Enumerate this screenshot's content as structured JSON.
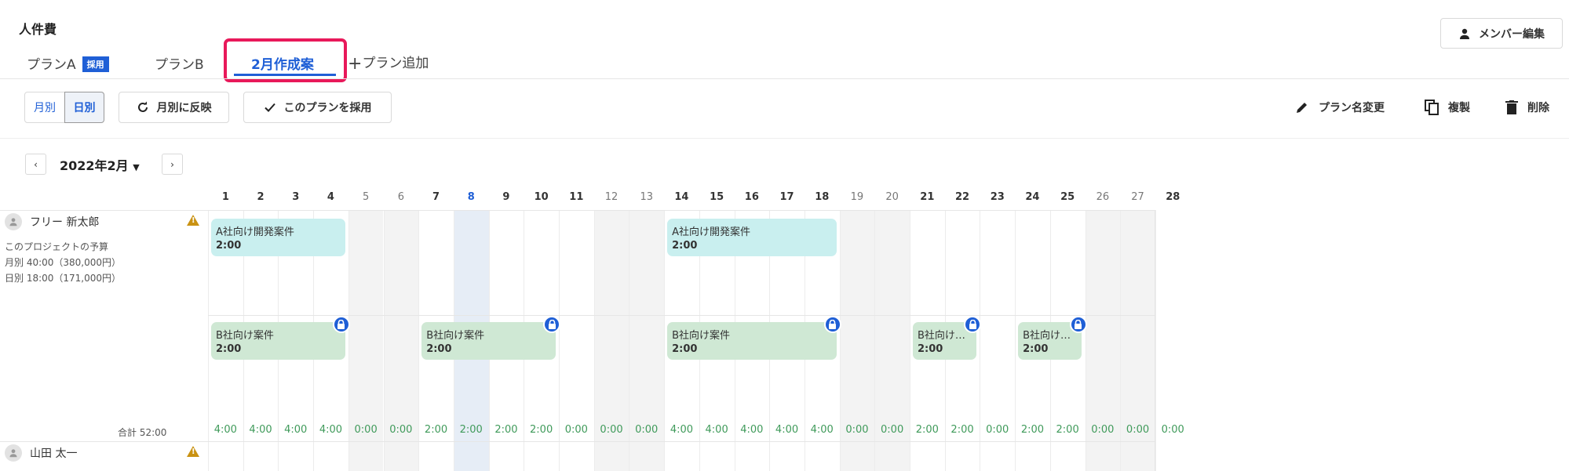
{
  "header": {
    "title": "人件費",
    "member_button": "メンバー編集"
  },
  "tabs": [
    {
      "label": "プランA",
      "badge": "採用"
    },
    {
      "label": "プランB"
    },
    {
      "label": "2月作成案"
    },
    {
      "label": "プラン追加"
    }
  ],
  "toolbar": {
    "view_monthly": "月別",
    "view_daily": "日別",
    "reflect_monthly": "月別に反映",
    "adopt_plan": "このプランを採用",
    "rename": "プラン名変更",
    "duplicate": "複製",
    "delete": "削除"
  },
  "month_nav": {
    "prev": "‹",
    "label": "2022年2月",
    "next": "›"
  },
  "days": [
    1,
    2,
    3,
    4,
    5,
    6,
    7,
    8,
    9,
    10,
    11,
    12,
    13,
    14,
    15,
    16,
    17,
    18,
    19,
    20,
    21,
    22,
    23,
    24,
    25,
    26,
    27,
    28
  ],
  "members": [
    {
      "name": "フリー 新太郎",
      "budget_title": "このプロジェクトの予算",
      "budget_monthly": "月別 40:00（380,000円）",
      "budget_daily": "日別 18:00（171,000円）",
      "total": "合計 52:00",
      "daily_totals": [
        "4:00",
        "4:00",
        "4:00",
        "4:00",
        "0:00",
        "0:00",
        "2:00",
        "2:00",
        "2:00",
        "2:00",
        "0:00",
        "0:00",
        "0:00",
        "4:00",
        "4:00",
        "4:00",
        "4:00",
        "4:00",
        "0:00",
        "0:00",
        "2:00",
        "2:00",
        "0:00",
        "2:00",
        "2:00",
        "0:00",
        "0:00",
        "0:00"
      ],
      "bars": [
        {
          "project": "A社向け開発案件",
          "hours": "2:00",
          "start": 1,
          "end": 4,
          "row": 0,
          "locked": false
        },
        {
          "project": "A社向け開発案件",
          "hours": "2:00",
          "start": 14,
          "end": 18,
          "row": 0,
          "locked": false
        },
        {
          "project": "B社向け案件",
          "hours": "2:00",
          "start": 1,
          "end": 4,
          "row": 1,
          "locked": true
        },
        {
          "project": "B社向け案件",
          "hours": "2:00",
          "start": 7,
          "end": 10,
          "row": 1,
          "locked": true
        },
        {
          "project": "B社向け案件",
          "hours": "2:00",
          "start": 14,
          "end": 18,
          "row": 1,
          "locked": true
        },
        {
          "project": "B社向け…",
          "hours": "2:00",
          "start": 21,
          "end": 22,
          "row": 1,
          "locked": true
        },
        {
          "project": "B社向け…",
          "hours": "2:00",
          "start": 24,
          "end": 25,
          "row": 1,
          "locked": true
        }
      ]
    },
    {
      "name": "山田 太一"
    }
  ]
}
